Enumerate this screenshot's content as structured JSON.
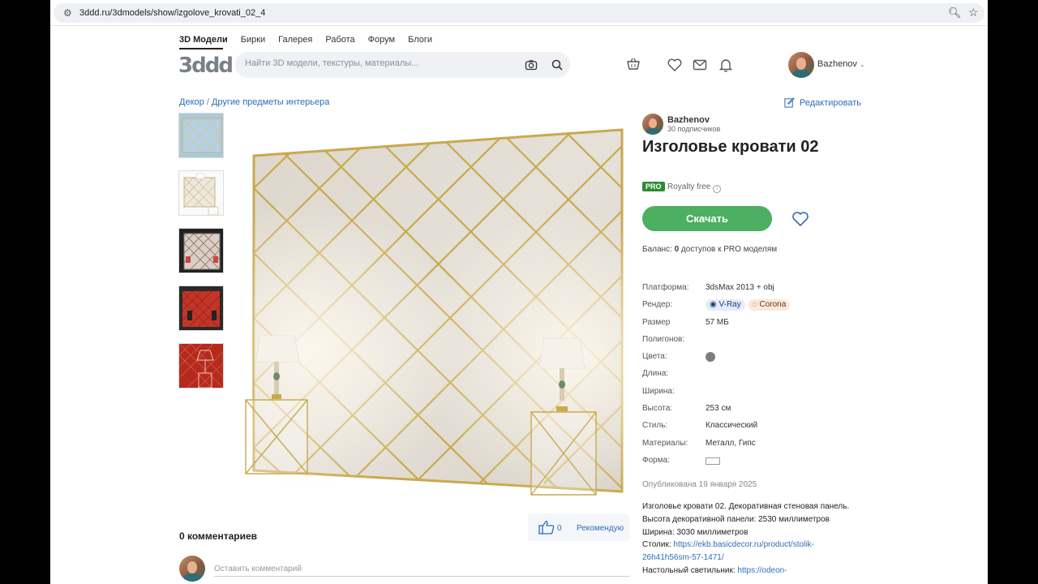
{
  "browser": {
    "url": "3ddd.ru/3dmodels/show/izgolove_krovati_02_4"
  },
  "topnav": [
    {
      "label": "3D Модели",
      "active": true
    },
    {
      "label": "Бирки"
    },
    {
      "label": "Галерея"
    },
    {
      "label": "Работа"
    },
    {
      "label": "Форум"
    },
    {
      "label": "Блоги"
    }
  ],
  "header": {
    "logo": "3ddd",
    "search_placeholder": "Найти 3D модели, текстуры, материалы...",
    "username": "Bazhenov"
  },
  "breadcrumb": {
    "parent": "Декор",
    "separator": "/",
    "current": "Другие предметы интерьера"
  },
  "edit_label": "Редактировать",
  "author": {
    "name": "Bazhenov",
    "subscribers": "30 подписчиков"
  },
  "model": {
    "title": "Изголовье кровати 02",
    "pro_badge": "PRO",
    "license": "Royalty free",
    "download_label": "Скачать",
    "balance_prefix": "Баланс: ",
    "balance_count": "0",
    "balance_suffix": " доступов к PRO моделям"
  },
  "specs": {
    "platform_label": "Платформа:",
    "platform_value": "3dsMax 2013 + obj",
    "render_label": "Рендер:",
    "render_vray": "V-Ray",
    "render_corona": "Corona",
    "size_label": "Размер",
    "size_value": "57 МБ",
    "polygons_label": "Полигонов:",
    "colors_label": "Цвета:",
    "color_value": "#7b7d80",
    "length_label": "Длина:",
    "width_label": "Ширина:",
    "height_label": "Высота:",
    "height_value": "253 см",
    "style_label": "Стиль:",
    "style_value": "Классический",
    "materials_label": "Материалы:",
    "materials_value": "Металл, Гипс",
    "shape_label": "Форма:"
  },
  "published": "Опубликована 19 января 2025",
  "description": {
    "line1": "Изголовье кровати 02. Декоративная стеновая панель.",
    "line2": "Высота декоративной панели: 2530 миллиметров",
    "line3": "Ширина: 3030 миллиметров",
    "table_label": "Столик: ",
    "table_link": "https://ekb.basicdecor.ru/product/stolik-26h41h56sm-57-1471/",
    "lamp_label": "Настольный светильник: ",
    "lamp_link": "https://odeon-"
  },
  "likes": {
    "count": "0",
    "recommend_label": "Рекомендую"
  },
  "comments": {
    "title": "0 комментариев",
    "placeholder": "Оставить комментарий"
  }
}
